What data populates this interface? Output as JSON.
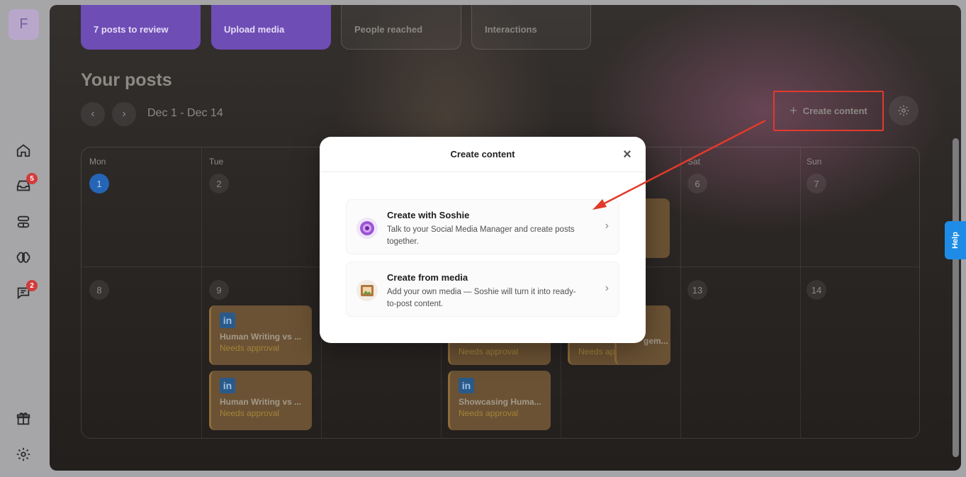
{
  "sidebar": {
    "avatar_letter": "F",
    "inbox_badge": "5",
    "comments_badge": "2"
  },
  "stats": {
    "posts_to_review": "7 posts to review",
    "upload_media": "Upload media",
    "people_reached": "People reached",
    "interactions": "Interactions"
  },
  "header": {
    "title": "Your posts",
    "prev": "‹",
    "next": "›",
    "date_range": "Dec 1 - Dec 14",
    "create_label": "Create content"
  },
  "calendar": {
    "days": [
      "Mon",
      "Tue",
      "Sat",
      "Sun"
    ],
    "week1": [
      "1",
      "2",
      "6",
      "7"
    ],
    "week2": [
      "8",
      "9",
      "13",
      "14"
    ],
    "posts": [
      {
        "title": "Human Writing vs ...",
        "status": "Needs approval",
        "network": "in"
      },
      {
        "title": "Human Writing vs ...",
        "status": "Needs approval",
        "network": "in"
      },
      {
        "title": "Showcasing Huma...",
        "status": "Needs approval",
        "network": "in"
      },
      {
        "title": "Needs approval",
        "status": ""
      },
      {
        "title": "Needs approval",
        "status": ""
      },
      {
        "title": "m...",
        "status": ""
      },
      {
        "title": "gem...",
        "status": ""
      }
    ]
  },
  "help": {
    "label": "Help"
  },
  "modal": {
    "title": "Create content",
    "close": "×",
    "options": [
      {
        "title": "Create with Soshie",
        "description": "Talk to your Social Media Manager and create posts together."
      },
      {
        "title": "Create from media",
        "description": "Add your own media — Soshie will turn it into ready-to-post content."
      }
    ]
  },
  "colors": {
    "accent_purple": "#6e4db5",
    "highlight_red": "#e23a2a",
    "today_blue": "#2465b6",
    "help_blue": "#1e8ce6"
  }
}
